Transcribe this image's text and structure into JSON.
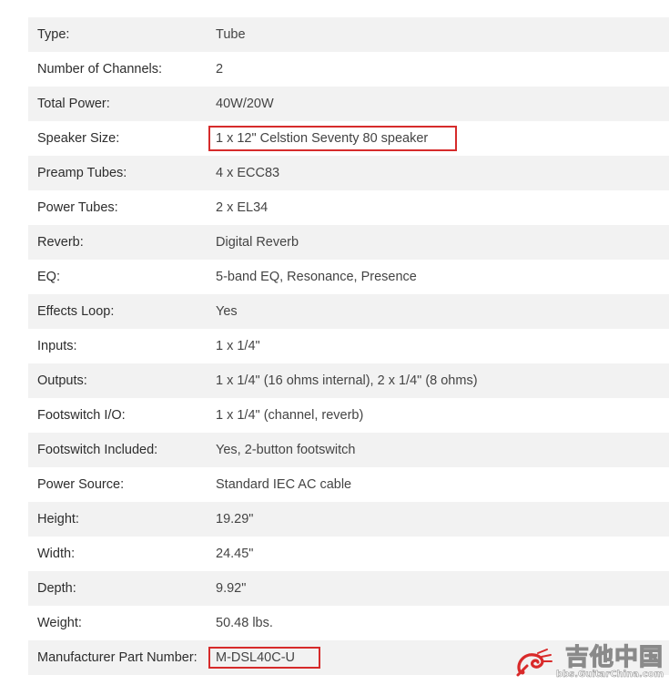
{
  "specs": [
    {
      "label": "Type:",
      "value": "Tube"
    },
    {
      "label": "Number of Channels:",
      "value": "2"
    },
    {
      "label": "Total Power:",
      "value": "40W/20W"
    },
    {
      "label": "Speaker Size:",
      "value": "1 x 12\" Celstion Seventy 80 speaker"
    },
    {
      "label": "Preamp Tubes:",
      "value": "4 x ECC83"
    },
    {
      "label": "Power Tubes:",
      "value": "2 x EL34"
    },
    {
      "label": "Reverb:",
      "value": "Digital Reverb"
    },
    {
      "label": "EQ:",
      "value": "5-band EQ, Resonance, Presence"
    },
    {
      "label": "Effects Loop:",
      "value": "Yes"
    },
    {
      "label": "Inputs:",
      "value": "1 x 1/4\""
    },
    {
      "label": "Outputs:",
      "value": "1 x 1/4\" (16 ohms internal), 2 x 1/4\" (8 ohms)"
    },
    {
      "label": "Footswitch I/O:",
      "value": "1 x 1/4\" (channel, reverb)"
    },
    {
      "label": "Footswitch Included:",
      "value": "Yes, 2-button footswitch"
    },
    {
      "label": "Power Source:",
      "value": "Standard IEC AC cable"
    },
    {
      "label": "Height:",
      "value": "19.29\""
    },
    {
      "label": "Width:",
      "value": "24.45\""
    },
    {
      "label": "Depth:",
      "value": "9.92\""
    },
    {
      "label": "Weight:",
      "value": "50.48 lbs."
    },
    {
      "label": "Manufacturer Part Number:",
      "value": "M-DSL40C-U"
    }
  ],
  "colors": {
    "row_alt": "#f2f2f2",
    "highlight_box": "#d62b2b",
    "text": "#333333"
  },
  "watermark": {
    "chinese": "吉他中国",
    "url": "bbs.GuitarChina.com",
    "logo_icon": "guitar-swirl-icon"
  }
}
